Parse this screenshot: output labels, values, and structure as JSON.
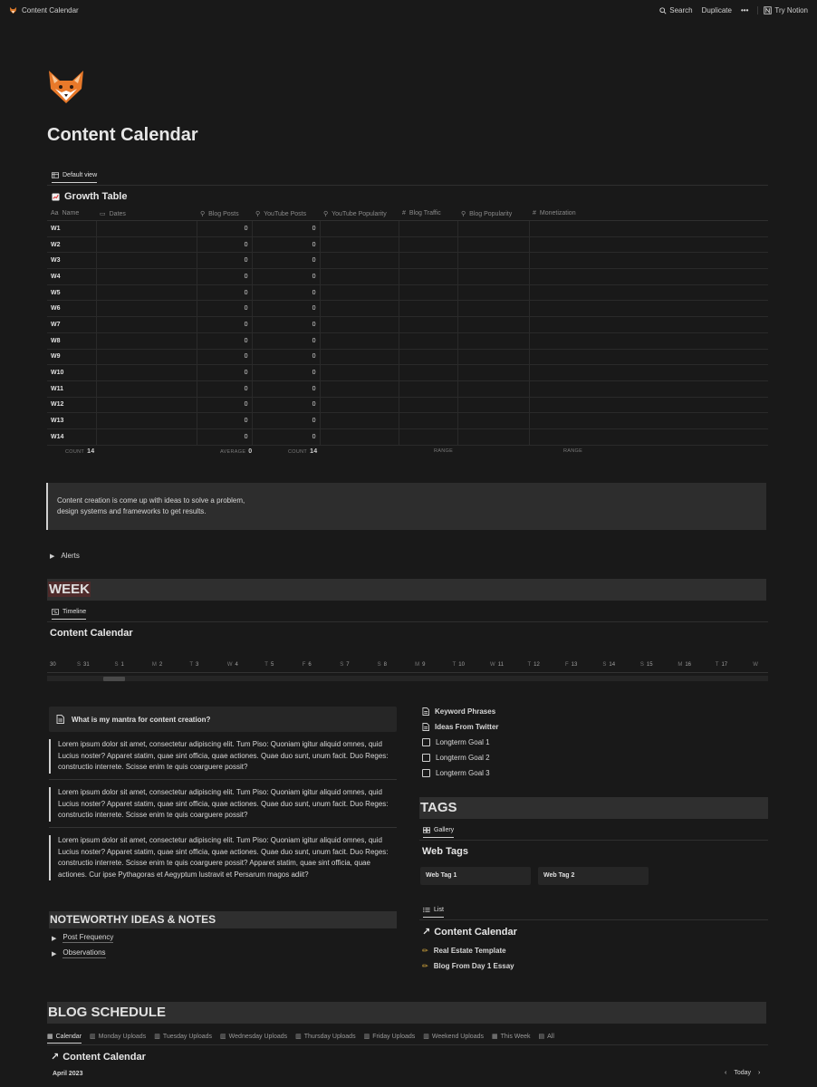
{
  "topbar": {
    "page_name": "Content Calendar",
    "search": "Search",
    "duplicate": "Duplicate",
    "more": "•••",
    "try_notion": "Try Notion"
  },
  "page": {
    "title": "Content Calendar"
  },
  "growth": {
    "view_tab": "Default view",
    "title": "Growth Table",
    "columns": [
      "Name",
      "Dates",
      "Blog Posts",
      "YouTube Posts",
      "YouTube Popularity",
      "Blog Traffic",
      "Blog Popularity",
      "Monetization"
    ],
    "column_icons": [
      "Aa",
      "cal",
      "search",
      "search",
      "search",
      "#",
      "search",
      "#"
    ],
    "rows": [
      {
        "name": "W1",
        "blog": "0",
        "yt": "0"
      },
      {
        "name": "W2",
        "blog": "0",
        "yt": "0"
      },
      {
        "name": "W3",
        "blog": "0",
        "yt": "0"
      },
      {
        "name": "W4",
        "blog": "0",
        "yt": "0"
      },
      {
        "name": "W5",
        "blog": "0",
        "yt": "0"
      },
      {
        "name": "W6",
        "blog": "0",
        "yt": "0"
      },
      {
        "name": "W7",
        "blog": "0",
        "yt": "0"
      },
      {
        "name": "W8",
        "blog": "0",
        "yt": "0"
      },
      {
        "name": "W9",
        "blog": "0",
        "yt": "0"
      },
      {
        "name": "W10",
        "blog": "0",
        "yt": "0"
      },
      {
        "name": "W11",
        "blog": "0",
        "yt": "0"
      },
      {
        "name": "W12",
        "blog": "0",
        "yt": "0"
      },
      {
        "name": "W13",
        "blog": "0",
        "yt": "0"
      },
      {
        "name": "W14",
        "blog": "0",
        "yt": "0"
      }
    ],
    "calc": {
      "count_label": "COUNT",
      "count_value": "14",
      "average_label": "AVERAGE",
      "average_value": "0",
      "count2_label": "COUNT",
      "count2_value": "14",
      "range1_label": "RANGE",
      "range2_label": "RANGE"
    }
  },
  "callout": {
    "line1": "Content creation is come up with ideas to solve a problem,",
    "line2": "design systems and frameworks to get results."
  },
  "alerts_toggle": "Alerts",
  "week": {
    "heading": "WEEK",
    "view_tab": "Timeline",
    "title": "Content Calendar",
    "days": [
      {
        "l": "",
        "n": "30"
      },
      {
        "l": "S",
        "n": "31"
      },
      {
        "l": "S",
        "n": "1"
      },
      {
        "l": "M",
        "n": "2"
      },
      {
        "l": "T",
        "n": "3"
      },
      {
        "l": "W",
        "n": "4"
      },
      {
        "l": "T",
        "n": "5"
      },
      {
        "l": "F",
        "n": "6"
      },
      {
        "l": "S",
        "n": "7"
      },
      {
        "l": "S",
        "n": "8"
      },
      {
        "l": "M",
        "n": "9"
      },
      {
        "l": "T",
        "n": "10"
      },
      {
        "l": "W",
        "n": "11"
      },
      {
        "l": "T",
        "n": "12"
      },
      {
        "l": "F",
        "n": "13"
      },
      {
        "l": "S",
        "n": "14"
      },
      {
        "l": "S",
        "n": "15"
      },
      {
        "l": "M",
        "n": "16"
      },
      {
        "l": "T",
        "n": "17"
      },
      {
        "l": "W",
        "n": ""
      }
    ]
  },
  "mantra": {
    "question": "What is my mantra for content creation?",
    "quote1": "Lorem ipsum dolor sit amet, consectetur adipiscing elit. Tum Piso: Quoniam igitur aliquid omnes, quid Lucius noster? Apparet statim, quae sint officia, quae actiones. Quae duo sunt, unum facit. Duo Reges: constructio interrete. Scisse enim te quis coarguere possit?",
    "quote2": "Lorem ipsum dolor sit amet, consectetur adipiscing elit. Tum Piso: Quoniam igitur aliquid omnes, quid Lucius noster? Apparet statim, quae sint officia, quae actiones. Quae duo sunt, unum facit. Duo Reges: constructio interrete. Scisse enim te quis coarguere possit?",
    "quote3": "Lorem ipsum dolor sit amet, consectetur adipiscing elit. Tum Piso: Quoniam igitur aliquid omnes, quid Lucius noster? Apparet statim, quae sint officia, quae actiones. Quae duo sunt, unum facit. Duo Reges: constructio interrete. Scisse enim te quis coarguere possit? Apparet statim, quae sint officia, quae actiones. Cur ipse Pythagoras et Aegyptum lustravit et Persarum magos adiit?"
  },
  "noteworthy": {
    "heading": "NOTEWORTHY IDEAS & NOTES",
    "items": [
      "Post Frequency",
      "Observations"
    ]
  },
  "right_links": {
    "keyword": "Keyword Phrases",
    "twitter": "Ideas From Twitter",
    "goal1": "Longterm Goal 1",
    "goal2": "Longterm Goal 2",
    "goal3": "Longterm Goal 3"
  },
  "tags": {
    "heading": "TAGS",
    "view_tab": "Gallery",
    "title": "Web Tags",
    "cards": [
      "Web Tag 1",
      "Web Tag 2"
    ]
  },
  "list": {
    "view_tab": "List",
    "title": "Content Calendar",
    "items": [
      "Real Estate Template",
      "Blog From Day 1 Essay"
    ]
  },
  "blog": {
    "heading": "BLOG SCHEDULE",
    "tabs": [
      "Calendar",
      "Monday Uploads",
      "Tuesday Uploads",
      "Wednesday Uploads",
      "Thursday Uploads",
      "Friday Uploads",
      "Weekend Uploads",
      "This Week",
      "All"
    ],
    "title": "Content Calendar",
    "month": "April 2023",
    "today": "Today"
  }
}
